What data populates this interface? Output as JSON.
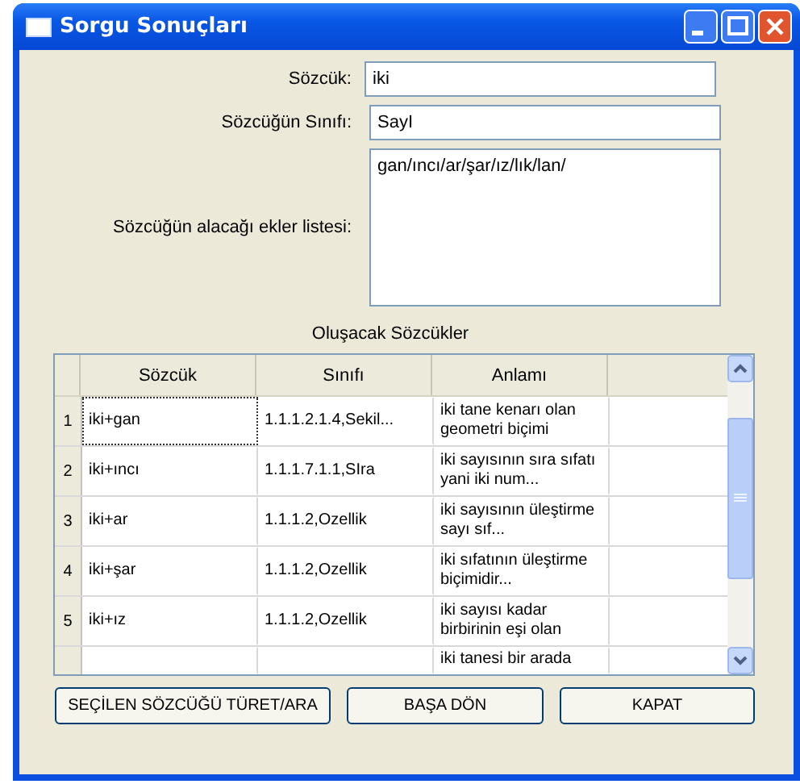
{
  "window": {
    "title": "Sorgu Sonuçları"
  },
  "fields": [
    {
      "label": "Sözcük:",
      "value": "iki",
      "kind": "line"
    },
    {
      "label": "Sözcüğün Sınıfı:",
      "value": "SayI",
      "kind": "line"
    },
    {
      "label": "Sözcüğün alacağı ekler listesi:",
      "value": "gan/ıncı/ar/şar/ız/lık/lan/",
      "kind": "area"
    }
  ],
  "table": {
    "title": "Oluşacak Sözcükler",
    "columns": [
      "Sözcük",
      "Sınıfı",
      "Anlamı"
    ],
    "rows": [
      {
        "number": "1",
        "cells": [
          "iki+gan",
          "1.1.1.2.1.4,Sekil...",
          "iki tane kenarı olan geometri biçimi"
        ],
        "focused": true
      },
      {
        "number": "2",
        "cells": [
          "iki+ıncı",
          "1.1.1.7.1.1,SIra",
          "iki sayısının sıra sıfatı yani iki num..."
        ],
        "focused": false
      },
      {
        "number": "3",
        "cells": [
          "iki+ar",
          "1.1.1.2,Ozellik",
          "iki sayısının üleştirme sayı sıf..."
        ],
        "focused": false
      },
      {
        "number": "4",
        "cells": [
          "iki+şar",
          "1.1.1.2,Ozellik",
          "iki sıfatının üleştirme biçimidir..."
        ],
        "focused": false
      },
      {
        "number": "5",
        "cells": [
          "iki+ız",
          "1.1.1.2,Ozellik",
          "iki sayısı kadar birbirinin eşi olan"
        ],
        "focused": false
      },
      {
        "cells": [
          "",
          "",
          "iki tanesi bir arada"
        ],
        "focused": false
      }
    ]
  },
  "buttons": [
    "SEÇİLEN SÖZCÜĞÜ TÜRET/ARA",
    "BAŞA DÖN",
    "KAPAT"
  ]
}
